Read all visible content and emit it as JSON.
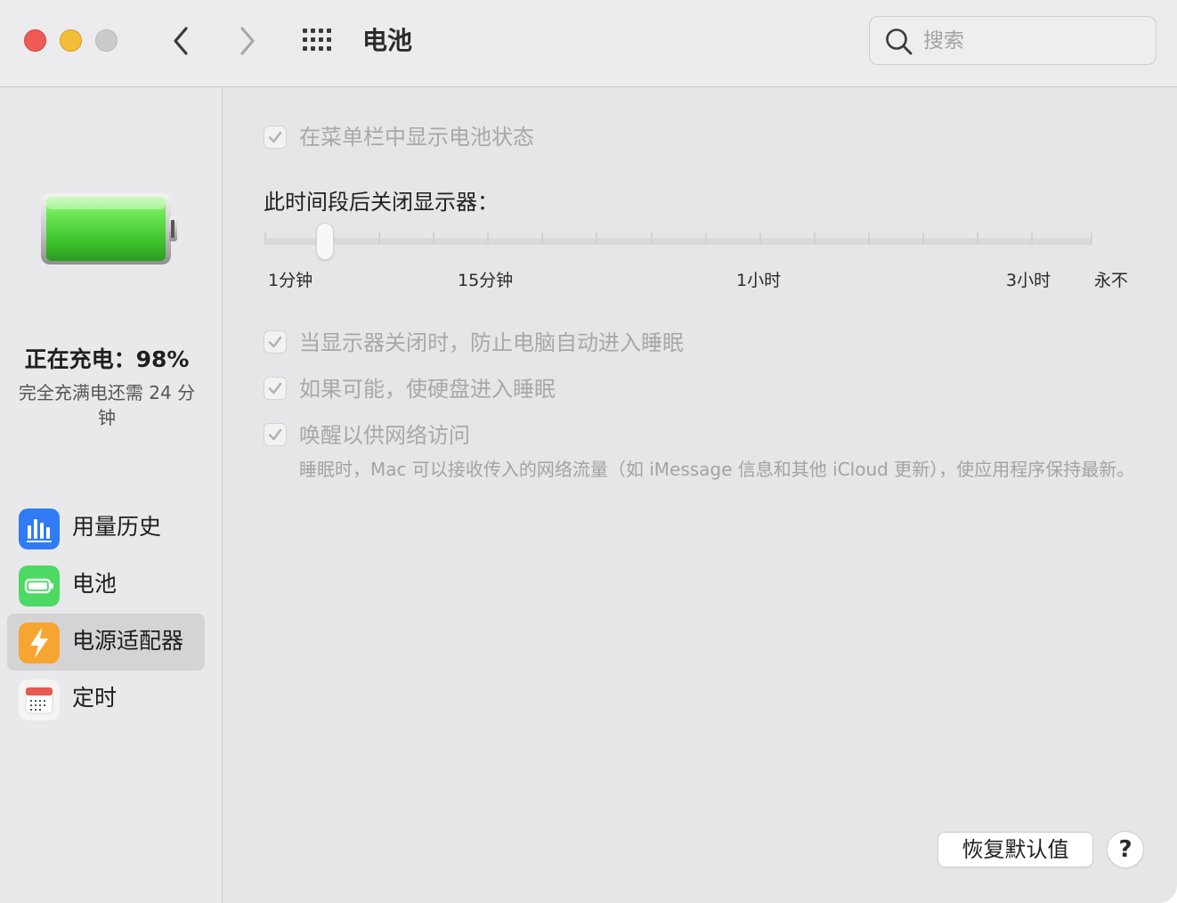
{
  "window": {
    "title": "电池",
    "search": {
      "placeholder": "搜索",
      "value": ""
    }
  },
  "sidebar": {
    "status": {
      "charging_label": "正在充电：98%",
      "remaining_label": "完全充满电还需 24 分钟"
    },
    "items": [
      {
        "label": "用量历史",
        "icon": "bar-chart-icon"
      },
      {
        "label": "电池",
        "icon": "battery-icon"
      },
      {
        "label": "电源适配器",
        "icon": "lightning-icon",
        "selected": true
      },
      {
        "label": "定时",
        "icon": "calendar-icon"
      }
    ]
  },
  "main": {
    "show_status_in_menubar": {
      "label": "在菜单栏中显示电池状态",
      "checked": true,
      "enabled": false
    },
    "display_off_label": "此时间段后关闭显示器：",
    "slider": {
      "labels": [
        "1分钟",
        "15分钟",
        "1小时",
        "3小时",
        "永不"
      ],
      "value": "2分钟"
    },
    "prevent_sleep": {
      "label": "当显示器关闭时，防止电脑自动进入睡眠",
      "checked": true,
      "enabled": false
    },
    "disk_sleep": {
      "label": "如果可能，使硬盘进入睡眠",
      "checked": true,
      "enabled": false
    },
    "wake_network": {
      "label": "唤醒以供网络访问",
      "checked": true,
      "enabled": false,
      "description": "睡眠时，Mac 可以接收传入的网络流量（如 iMessage 信息和其他 iCloud 更新），使应用程序保持最新。"
    },
    "restore_defaults_label": "恢复默认值",
    "help_label": "?"
  },
  "colors": {
    "accent_red": "#ee5b57",
    "accent_yellow": "#f4bd37",
    "battery_green": "#4cd964",
    "icon_blue": "#2f7cf6",
    "icon_orange": "#f7a531"
  }
}
